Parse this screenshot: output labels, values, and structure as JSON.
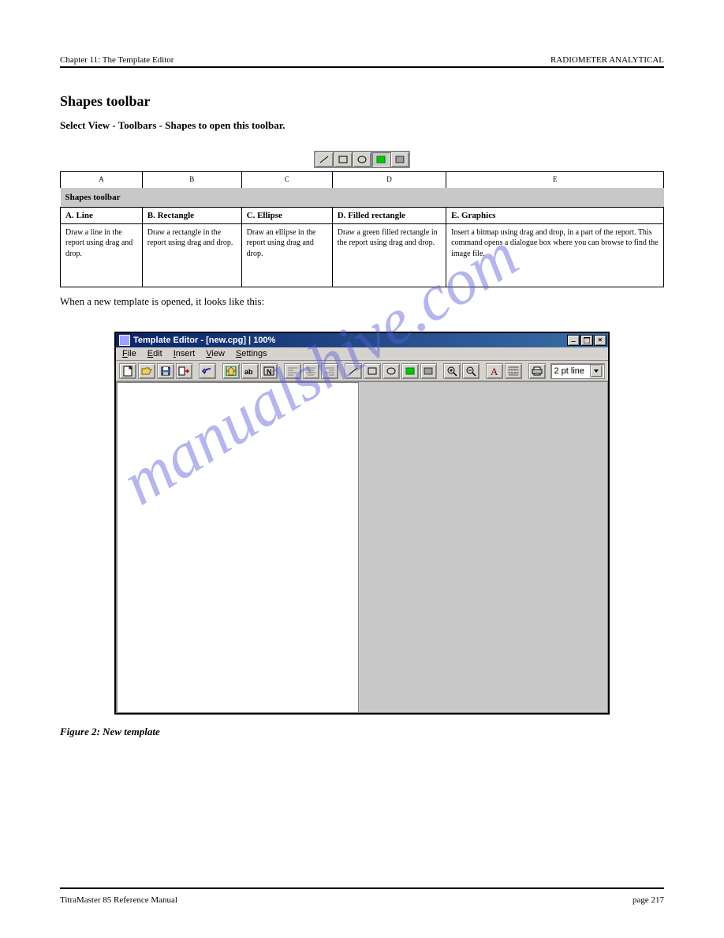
{
  "header": {
    "left": "Chapter 11: The Template Editor",
    "right": "RADIOMETER ANALYTICAL"
  },
  "footer": {
    "left": "TitraMaster 85 Reference Manual",
    "right": "page 217"
  },
  "watermark": "manualshive.com",
  "section": {
    "title": "Shapes toolbar",
    "subtitle": "Select View - Toolbars - Shapes to open this toolbar."
  },
  "shapes_toolbar_labels": [
    "A",
    "B",
    "C",
    "D",
    "E"
  ],
  "table": {
    "band": "Shapes toolbar",
    "cols": [
      {
        "name": "A. Line",
        "desc": "Draw a line in the report using drag and drop."
      },
      {
        "name": "B. Rectangle",
        "desc": "Draw a rectangle in the report using drag and drop."
      },
      {
        "name": "C. Ellipse",
        "desc": "Draw an ellipse in the report using drag and drop."
      },
      {
        "name": "D. Filled rectangle",
        "desc": "Draw a green filled rectangle in the report using drag and drop."
      },
      {
        "name": "E. Graphics",
        "desc": "Insert a bitmap using drag and drop, in a part of the report. This command opens a dialogue box where you can browse to find the image file."
      }
    ]
  },
  "figure": {
    "caption": "Figure 2: New template",
    "para": "When a new template is opened, it looks like this:",
    "app": {
      "title": "Template Editor - [new.cpg] | 100%",
      "menus": [
        {
          "label": "File",
          "u": "F"
        },
        {
          "label": "Edit",
          "u": "E"
        },
        {
          "label": "Insert",
          "u": "I"
        },
        {
          "label": "View",
          "u": "V"
        },
        {
          "label": "Settings",
          "u": "S"
        }
      ],
      "dropdown": "2 pt line"
    }
  }
}
